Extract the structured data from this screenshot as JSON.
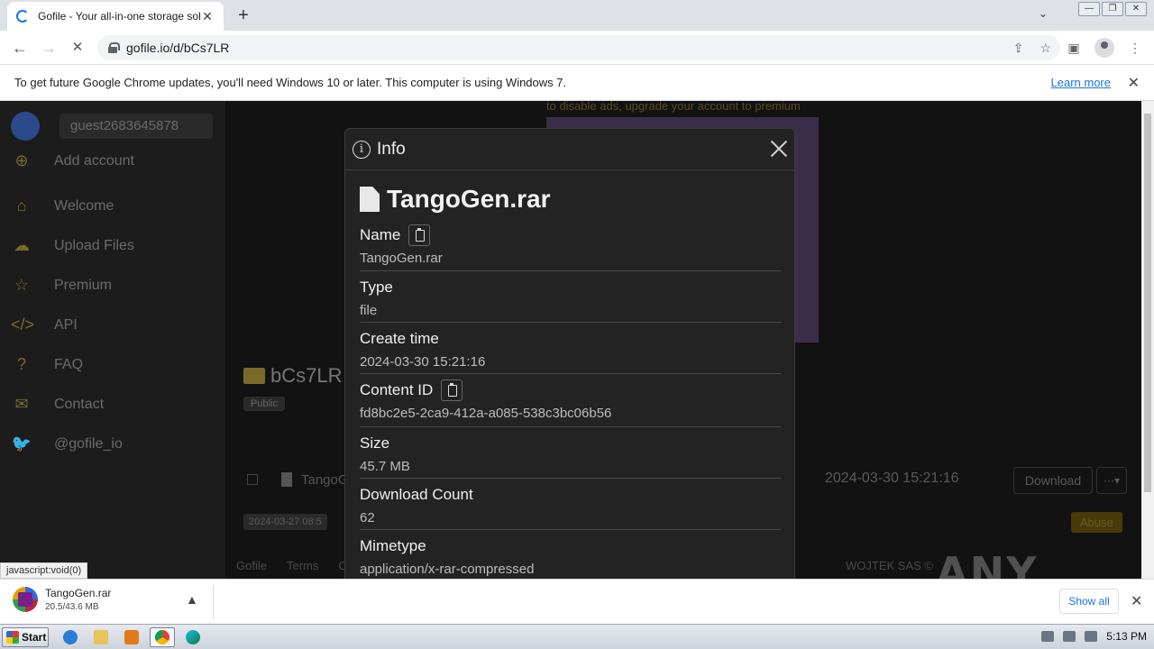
{
  "browser": {
    "tab_title": "Gofile - Your all-in-one storage soluti",
    "tab_close": "✕",
    "new_tab": "+",
    "tab_dropdown": "⌄",
    "url": "gofile.io/d/bCs7LR",
    "win_controls": [
      "—",
      "❐",
      "✕"
    ],
    "nav": {
      "back": "←",
      "forward": "→",
      "reload": "✕"
    },
    "omni_icons": {
      "share": "⇪",
      "star": "☆"
    },
    "toolbar_icons": {
      "sidepanel": "▣",
      "menu": "⋮"
    }
  },
  "infobar": {
    "message": "To get future Google Chrome updates, you'll need Windows 10 or later. This computer is using Windows 7.",
    "learn_more": "Learn more",
    "close": "✕"
  },
  "page": {
    "user": "guest2683645878",
    "sidebar": [
      {
        "icon": "add-user-icon",
        "glyph": "⊕",
        "label": "Add account"
      },
      {
        "icon": "home-icon",
        "glyph": "⌂",
        "label": "Welcome"
      },
      {
        "icon": "upload-icon",
        "glyph": "☁",
        "label": "Upload Files"
      },
      {
        "icon": "star-icon",
        "glyph": "☆",
        "label": "Premium"
      },
      {
        "icon": "code-icon",
        "glyph": "</>",
        "label": "API"
      },
      {
        "icon": "question-icon",
        "glyph": "?",
        "label": "FAQ"
      },
      {
        "icon": "mail-icon",
        "glyph": "✉",
        "label": "Contact"
      },
      {
        "icon": "twitter-icon",
        "glyph": "🐦",
        "label": "@gofile_io"
      }
    ],
    "ad_text": "to disable ads, upgrade your account to premium",
    "folder_name": "bCs7LR",
    "public_badge": "Public",
    "file_name_partial": "TangoG",
    "file_date": "2024-03-30 15:21:16",
    "download_btn": "Download",
    "more_btn": "···▾",
    "abuse": "Abuse",
    "created_badge": "2024-03-27 08:5",
    "footer_links": [
      "Gofile",
      "Terms",
      "Co"
    ],
    "footer_right": "WOJTEK SAS ©"
  },
  "modal": {
    "title": "Info",
    "file_title": "TangoGen.rar",
    "fields": [
      {
        "label": "Name",
        "value": "TangoGen.rar",
        "copy": true
      },
      {
        "label": "Type",
        "value": "file",
        "copy": false
      },
      {
        "label": "Create time",
        "value": "2024-03-30 15:21:16",
        "copy": false
      },
      {
        "label": "Content ID",
        "value": "fd8bc2e5-2ca9-412a-a085-538c3bc06b56",
        "copy": true
      },
      {
        "label": "Size",
        "value": "45.7 MB",
        "copy": false
      },
      {
        "label": "Download Count",
        "value": "62",
        "copy": false
      },
      {
        "label": "Mimetype",
        "value": "application/x-rar-compressed",
        "copy": false
      }
    ]
  },
  "status_link": "javascript:void(0)",
  "downloads": {
    "file": "TangoGen.rar",
    "progress": "20.5/43.6 MB",
    "chevron": "▲",
    "show_all": "Show all",
    "close": "✕"
  },
  "watermark": "ANY RUN",
  "taskbar": {
    "start": "Start",
    "time": "5:13 PM"
  }
}
